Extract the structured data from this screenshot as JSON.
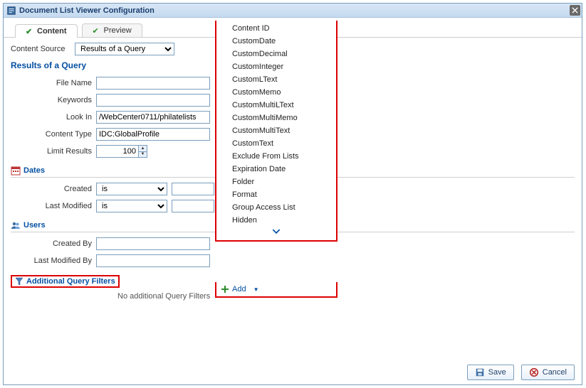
{
  "title": "Document List Viewer Configuration",
  "tabs": [
    {
      "label": "Content",
      "active": true
    },
    {
      "label": "Preview",
      "active": false
    }
  ],
  "content_source": {
    "label": "Content Source",
    "value": "Results of a Query"
  },
  "section_title": "Results of a Query",
  "fields": {
    "file_name": {
      "label": "File Name",
      "value": ""
    },
    "keywords": {
      "label": "Keywords",
      "value": ""
    },
    "look_in": {
      "label": "Look In",
      "value": "/WebCenter0711/philatelists"
    },
    "content_type": {
      "label": "Content Type",
      "value": "IDC:GlobalProfile"
    },
    "limit_results": {
      "label": "Limit Results",
      "value": "100"
    }
  },
  "dates_group": {
    "title": "Dates",
    "created": {
      "label": "Created",
      "op": "is",
      "value": ""
    },
    "last_modified": {
      "label": "Last Modified",
      "op": "is",
      "value": ""
    }
  },
  "users_group": {
    "title": "Users",
    "created_by": {
      "label": "Created By",
      "value": ""
    },
    "last_modified_by": {
      "label": "Last Modified By",
      "value": ""
    }
  },
  "aqf": {
    "title": "Additional Query Filters",
    "empty_text": "No additional Query Filters",
    "add_label": "Add"
  },
  "dropdown_items": [
    "Content ID",
    "CustomDate",
    "CustomDecimal",
    "CustomInteger",
    "CustomLText",
    "CustomMemo",
    "CustomMultiLText",
    "CustomMultiMemo",
    "CustomMultiText",
    "CustomText",
    "Exclude From Lists",
    "Expiration Date",
    "Folder",
    "Format",
    "Group Access List",
    "Hidden"
  ],
  "footer": {
    "save": "Save",
    "cancel": "Cancel"
  }
}
